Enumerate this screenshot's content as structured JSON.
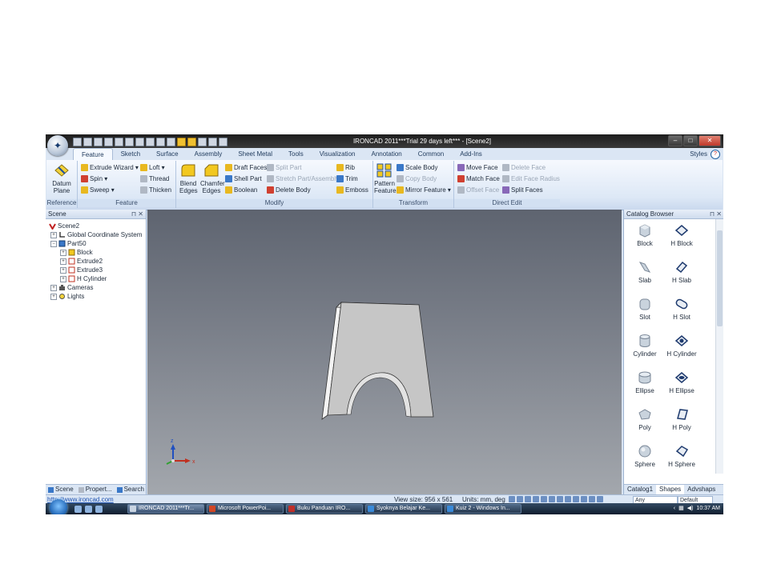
{
  "window": {
    "title": "IRONCAD 2011***Trial 29 days left*** - [Scene2]",
    "controls": [
      "–",
      "□",
      "✕"
    ]
  },
  "ribbon_tabs": [
    "Feature",
    "Sketch",
    "Surface",
    "Assembly",
    "Sheet Metal",
    "Tools",
    "Visualization",
    "Annotation",
    "Common",
    "Add-Ins"
  ],
  "styles_label": "Styles",
  "groups": {
    "reference": {
      "label": "Reference",
      "datum_plane": "Datum Plane"
    },
    "feature": {
      "label": "Feature",
      "items": [
        "Extrude Wizard",
        "Loft",
        "Spin",
        "Thread",
        "Sweep",
        "Thicken"
      ]
    },
    "modify": {
      "label": "Modify",
      "blend_edges": "Blend Edges",
      "chamfer_edges": "Chamfer Edges",
      "items": [
        "Draft Faces",
        "Split Part",
        "Rib",
        "Shell Part",
        "Stretch Part/Assembly",
        "Trim",
        "Boolean",
        "Delete Body",
        "Emboss"
      ]
    },
    "transform": {
      "label": "Transform",
      "pattern_feature": "Pattern Feature",
      "items": [
        "Scale Body",
        "Copy Body",
        "Mirror Feature"
      ]
    },
    "direct_edit": {
      "label": "Direct Edit",
      "items": [
        "Move Face",
        "Delete Face",
        "Match Face",
        "Edit Face Radius",
        "Offset Face",
        "Split Faces"
      ]
    }
  },
  "scene_panel": {
    "title": "Scene",
    "controls": "⊓ ✕",
    "tree": [
      {
        "label": "Scene2",
        "level": 0
      },
      {
        "label": "Global Coordinate System",
        "level": 1
      },
      {
        "label": "Part50",
        "level": 1
      },
      {
        "label": "Block",
        "level": 2
      },
      {
        "label": "Extrude2",
        "level": 2
      },
      {
        "label": "Extrude3",
        "level": 2
      },
      {
        "label": "H Cylinder",
        "level": 2
      },
      {
        "label": "Cameras",
        "level": 1
      },
      {
        "label": "Lights",
        "level": 1
      }
    ],
    "tabs": [
      "Scene",
      "Propert...",
      "Search"
    ]
  },
  "viewport": {
    "axis_labels": [
      "z",
      "x"
    ]
  },
  "catalog": {
    "title": "Catalog Browser",
    "controls": "⊓ ✕",
    "items": [
      [
        "Block",
        "H Block"
      ],
      [
        "Slab",
        "H Slab"
      ],
      [
        "Slot",
        "H Slot"
      ],
      [
        "Cylinder",
        "H Cylinder"
      ],
      [
        "Ellipse",
        "H Ellipse"
      ],
      [
        "Poly",
        "H Poly"
      ],
      [
        "Sphere",
        "H Sphere"
      ]
    ],
    "tabs": [
      "Catalog1",
      "Shapes",
      "Advshaps"
    ]
  },
  "status_bar": {
    "url": "http://www.ironcad.com",
    "view_size": "View size: 956 x 561",
    "units": "Units: mm, deg",
    "select_filter": "Any",
    "style_select": "Default"
  },
  "taskbar": {
    "buttons": [
      "IRONCAD 2011***Tr...",
      "Microsoft PowerPoi...",
      "Buku Panduan IRO...",
      "Syoknya Belajar Ke...",
      "Kuiz 2 - Windows In..."
    ],
    "clock": "10:37 AM"
  },
  "colors": {
    "ribbon_bg": "#dde8f6",
    "viewport_top": "#5e6470",
    "viewport_bottom": "#a3a7ad",
    "part_face": "#c6c6c6",
    "taskbar": "#1c2c40"
  }
}
